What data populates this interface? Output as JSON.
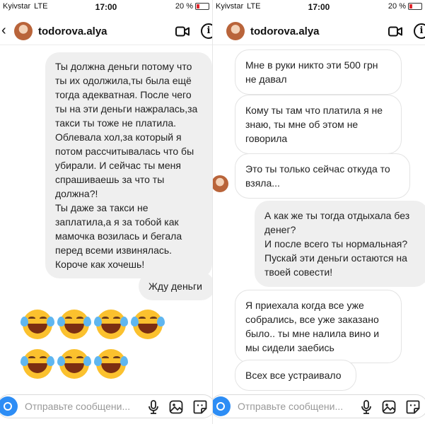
{
  "status": {
    "carrier": "Kyivstar",
    "network": "LTE",
    "time": "17:00",
    "battery": "20 %"
  },
  "header": {
    "username": "todorova.alya"
  },
  "composer": {
    "placeholder": "Отправьте сообщени..."
  },
  "left": {
    "messages": [
      {
        "who": "them",
        "text": "Ты должна деньги потому что ты их одолжила,ты была ещё тогда адекватная. После чего ты на эти деньги нажралась,за такси ты тоже не платила. Облевала хол,за который я потом рассчитывалась что бы убирали. И сейчас ты меня спрашиваешь за что ты должна?!\nТы даже за такси не заплатила,а я за тобой как мамочка возилась и бегала перед всеми извинялась.\nКороче как хочешь!"
      },
      {
        "who": "me",
        "text": "Жду деньги"
      }
    ],
    "emoji_rows": [
      4,
      3
    ]
  },
  "right": {
    "messages": [
      {
        "who": "them",
        "text": "Мне в руки никто эти 500 грн не давал"
      },
      {
        "who": "them",
        "text": "Кому ты там что платила я не знаю, ты мне об этом не говорила"
      },
      {
        "who": "them",
        "text": "Это ты только сейчас откуда то взяла..."
      },
      {
        "who": "me",
        "text": "А как же ты тогда отдыхала без денег?\nИ после всего ты нормальная?\nПускай эти деньги остаются на твоей совести!"
      },
      {
        "who": "them",
        "text": "Я приехала когда все уже собрались, все уже заказано было.. ты мне налила вино и мы сидели заебись"
      },
      {
        "who": "them",
        "text": "Всех все устраивало"
      }
    ]
  }
}
